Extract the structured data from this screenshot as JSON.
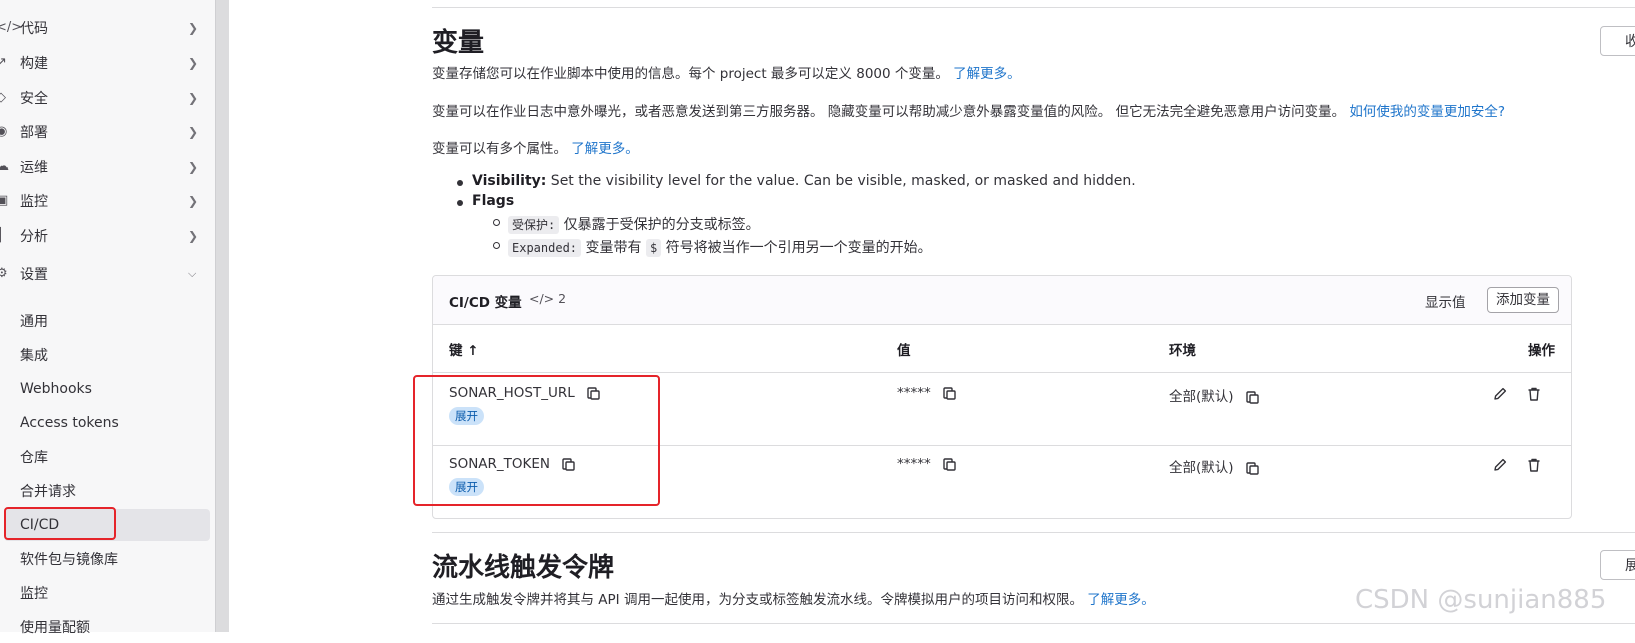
{
  "sidebar": {
    "items": [
      {
        "label": "代码",
        "icon": "code-icon"
      },
      {
        "label": "构建",
        "icon": "rocket-icon"
      },
      {
        "label": "安全",
        "icon": "shield-icon"
      },
      {
        "label": "部署",
        "icon": "deployments-icon"
      },
      {
        "label": "运维",
        "icon": "cloud-gear-icon"
      },
      {
        "label": "监控",
        "icon": "monitor-icon"
      },
      {
        "label": "分析",
        "icon": "chart-icon"
      }
    ],
    "settings": {
      "label": "设置",
      "icon": "settings-icon"
    },
    "sub_items": [
      {
        "label": "通用"
      },
      {
        "label": "集成"
      },
      {
        "label": "Webhooks"
      },
      {
        "label": "Access tokens"
      },
      {
        "label": "仓库"
      },
      {
        "label": "合并请求"
      },
      {
        "label": "CI/CD"
      },
      {
        "label": "软件包与镜像库"
      },
      {
        "label": "监控"
      },
      {
        "label": "使用量配额"
      }
    ]
  },
  "variables": {
    "title": "变量",
    "collapse_label": "收",
    "desc1": "变量存储您可以在作业脚本中使用的信息。每个 project 最多可以定义 8000 个变量。",
    "desc1_link": "了解更多。",
    "desc2": "变量可以在作业日志中意外曝光，或者恶意发送到第三方服务器。 隐藏变量可以帮助减少意外暴露变量值的风险。 但它无法完全避免恶意用户访问变量。",
    "desc2_link": "如何使我的变量更加安全?",
    "desc3": "变量可以有多个属性。",
    "desc3_link": "了解更多。",
    "bullet1_bold": "Visibility:",
    "bullet1_text": " Set the visibility level for the value. Can be visible, masked, or masked and hidden.",
    "bullet2_bold": "Flags",
    "flag1_code": "受保护:",
    "flag1_text": " 仅暴露于受保护的分支或标签。",
    "flag2_code": "Expanded:",
    "flag2_text_a": " 变量带有 ",
    "flag2_code2": "$",
    "flag2_text_b": " 符号将被当作一个引用另一个变量的开始。"
  },
  "card": {
    "title": "CI/CD 变量",
    "count": "2",
    "show_values": "显示值",
    "add_variable": "添加变量",
    "columns": {
      "key": "键 ↑",
      "value": "值",
      "env": "环境",
      "actions": "操作"
    },
    "rows": [
      {
        "key": "SONAR_HOST_URL",
        "badge": "展开",
        "value": "*****",
        "env": "全部(默认)"
      },
      {
        "key": "SONAR_TOKEN",
        "badge": "展开",
        "value": "*****",
        "env": "全部(默认)"
      }
    ]
  },
  "pipeline": {
    "title": "流水线触发令牌",
    "expand_label": "展",
    "desc": "通过生成触发令牌并将其与 API 调用一起使用，为分支或标签触发流水线。令牌模拟用户的项目访问和权限。",
    "desc_link": "了解更多。"
  },
  "watermark": "CSDN @sunjian885",
  "colors": {
    "link": "#1f75cb",
    "highlight_box": "#e5242a",
    "badge_bg": "#cbe2f9"
  }
}
